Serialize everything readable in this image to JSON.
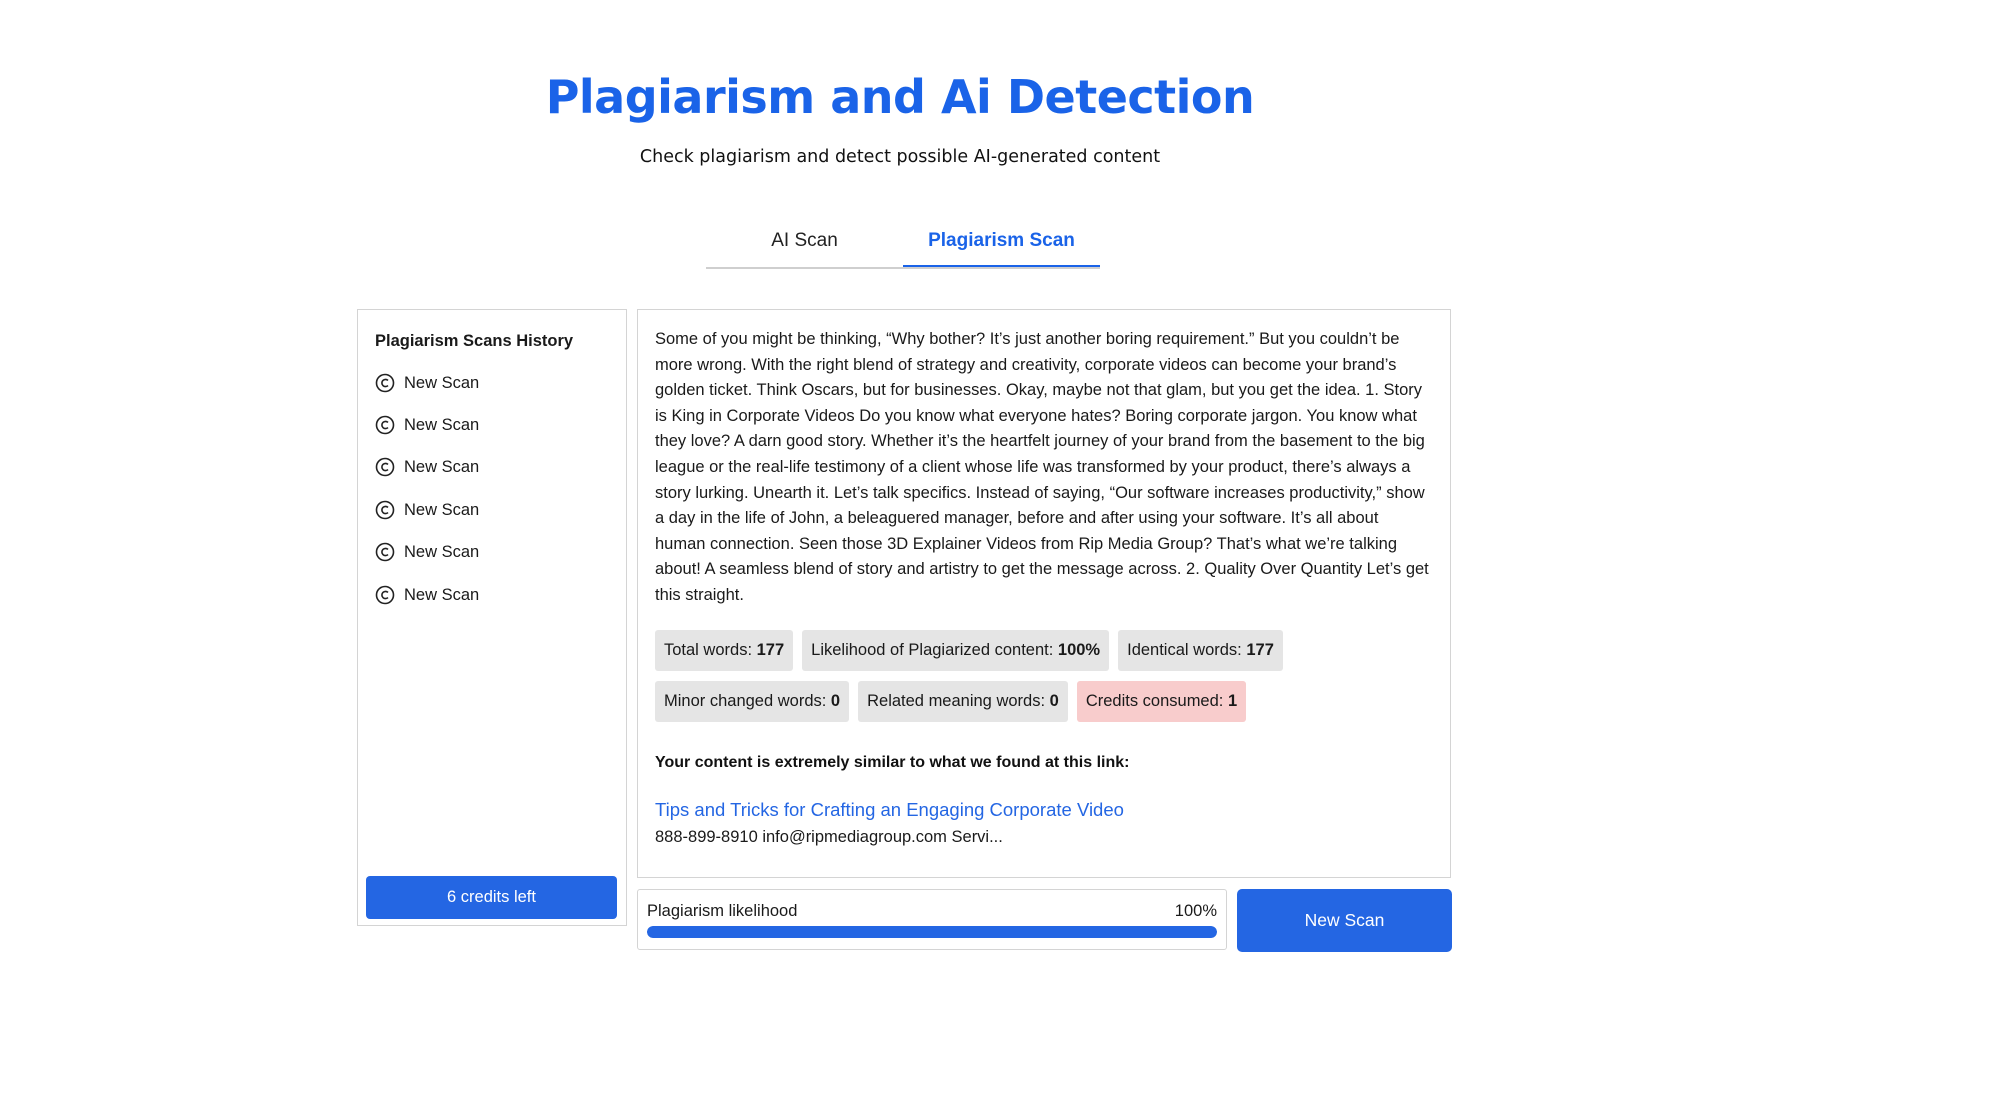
{
  "header": {
    "title": "Plagiarism and Ai Detection",
    "subtitle": "Check plagiarism and detect possible AI-generated content"
  },
  "tabs": [
    {
      "label": "AI Scan",
      "active": false
    },
    {
      "label": "Plagiarism Scan",
      "active": true
    }
  ],
  "sidebar": {
    "title": "Plagiarism Scans History",
    "items": [
      {
        "label": "New Scan",
        "icon": "copyright-icon"
      },
      {
        "label": "New Scan",
        "icon": "copyright-icon"
      },
      {
        "label": "New Scan",
        "icon": "copyright-icon"
      },
      {
        "label": "New Scan",
        "icon": "copyright-icon"
      },
      {
        "label": "New Scan",
        "icon": "copyright-icon"
      },
      {
        "label": "New Scan",
        "icon": "copyright-icon"
      }
    ],
    "credits_label": "6 credits left"
  },
  "content": {
    "text": "Some of you might be thinking, “Why bother? It’s just another boring requirement.” But you couldn’t be more wrong. With the right blend of strategy and creativity, corporate videos can become your brand’s golden ticket. Think Oscars, but for businesses. Okay, maybe not that glam, but you get the idea. 1. Story is King in Corporate Videos Do you know what everyone hates? Boring corporate jargon. You know what they love? A darn good story. Whether it’s the heartfelt journey of your brand from the basement to the big league or the real-life testimony of a client whose life was transformed by your product, there’s always a story lurking. Unearth it. Let’s talk specifics. Instead of saying, “Our software increases productivity,” show a day in the life of John, a beleaguered manager, before and after using your software. It’s all about human connection. Seen those 3D Explainer Videos from Rip Media Group? That’s what we’re talking about! A seamless blend of story and artistry to get the message across. 2. Quality Over Quantity Let’s get this straight."
  },
  "stats": {
    "total_words_label": "Total words: ",
    "total_words_value": "177",
    "likelihood_label": "Likelihood of Plagiarized content: ",
    "likelihood_value": "100%",
    "identical_label": "Identical words: ",
    "identical_value": "177",
    "minor_changed_label": "Minor changed words: ",
    "minor_changed_value": "0",
    "related_meaning_label": "Related meaning words: ",
    "related_meaning_value": "0",
    "credits_consumed_label": "Credits consumed: ",
    "credits_consumed_value": "1"
  },
  "result": {
    "heading": "Your content is extremely similar to what we found at this link:",
    "link_text": "Tips and Tricks for Crafting an Engaging Corporate Video",
    "snippet": "888-899-8910 info@ripmediagroup.com Servi..."
  },
  "likelihood_bar": {
    "label": "Plagiarism likelihood",
    "value_text": "100%",
    "fraction": 1.0
  },
  "actions": {
    "new_scan_label": "New Scan"
  },
  "colors": {
    "accent": "#1a63e8",
    "button": "#2466e3",
    "chip": "#e5e5e5",
    "chip_alert": "#f8cccc"
  }
}
